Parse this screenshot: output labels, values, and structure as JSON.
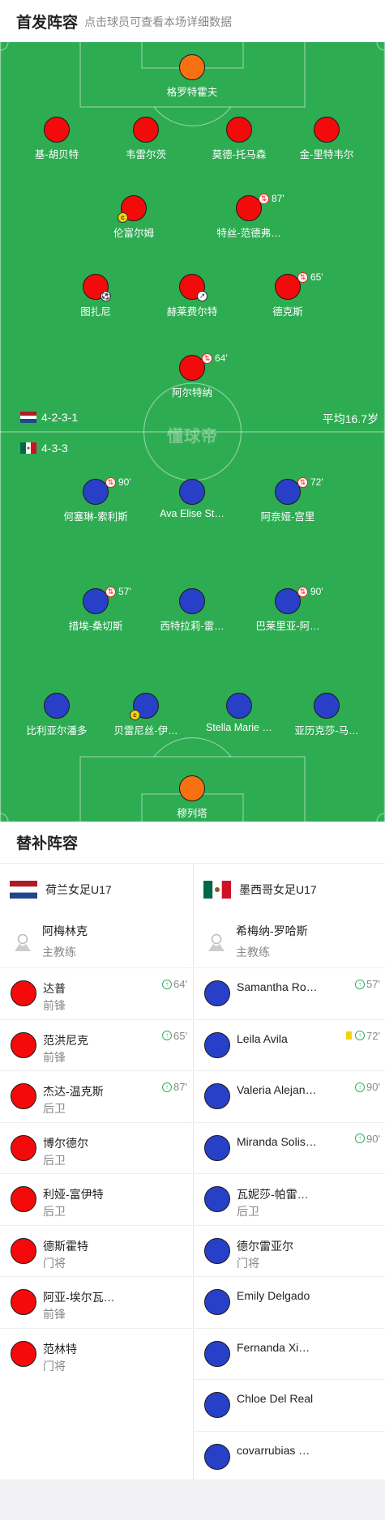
{
  "header": {
    "title": "首发阵容",
    "subtitle": "点击球员可查看本场详细数据"
  },
  "watermark": "懂球帝",
  "colors": {
    "home": "#f40a0a",
    "away": "#2840c8",
    "goalkeeper": "#f77113",
    "pitch": "#2eac52"
  },
  "home_team": {
    "name": "荷兰女足U17",
    "formation": "4-2-3-1",
    "flag": "netherlands-flag"
  },
  "away_team": {
    "name": "墨西哥女足U17",
    "formation": "4-3-3",
    "flag": "mexico-flag"
  },
  "average_age": "平均16.7岁",
  "home_lineup": [
    {
      "name": "格罗特霍夫",
      "kit": "orange"
    },
    {
      "name": "基-胡贝特",
      "kit": "red"
    },
    {
      "name": "韦雷尔茨",
      "kit": "red"
    },
    {
      "name": "莫德-托马森",
      "kit": "red"
    },
    {
      "name": "金-里特韦尔",
      "kit": "red"
    },
    {
      "name": "伦富尔姆",
      "kit": "red",
      "captain": "c"
    },
    {
      "name": "特丝-范德弗…",
      "kit": "red",
      "sub_minute": "87'"
    },
    {
      "name": "图扎尼",
      "kit": "red",
      "goal": true
    },
    {
      "name": "赫莱费尔特",
      "kit": "red",
      "assist": true
    },
    {
      "name": "德克斯",
      "kit": "red",
      "sub_minute": "65'"
    },
    {
      "name": "阿尔特纳",
      "kit": "red",
      "sub_minute": "64'"
    }
  ],
  "away_lineup": [
    {
      "name": "何塞琳-索利斯",
      "kit": "blue",
      "sub_minute": "90'"
    },
    {
      "name": "Ava Elise St…",
      "kit": "blue"
    },
    {
      "name": "阿奈娅-宫里",
      "kit": "blue",
      "sub_minute": "72'"
    },
    {
      "name": "措埃-桑切斯",
      "kit": "blue",
      "sub_minute": "57'"
    },
    {
      "name": "西特拉莉-雷…",
      "kit": "blue"
    },
    {
      "name": "巴莱里亚-阿…",
      "kit": "blue",
      "sub_minute": "90'"
    },
    {
      "name": "比利亚尔潘多",
      "kit": "blue"
    },
    {
      "name": "贝雷尼丝-伊…",
      "kit": "blue",
      "captain": "c"
    },
    {
      "name": "Stella Marie …",
      "kit": "blue"
    },
    {
      "name": "亚历克莎-马…",
      "kit": "blue"
    },
    {
      "name": "穆列塔",
      "kit": "orange"
    }
  ],
  "bench": {
    "title": "替补阵容",
    "home": {
      "coach": {
        "name": "阿梅林克",
        "role": "主教练"
      },
      "players": [
        {
          "name": "达普",
          "pos": "前锋",
          "minute": "64'"
        },
        {
          "name": "范洪尼克",
          "pos": "前锋",
          "minute": "65'"
        },
        {
          "name": "杰达-温克斯",
          "pos": "后卫",
          "minute": "87'"
        },
        {
          "name": "博尔德尔",
          "pos": "后卫"
        },
        {
          "name": "利娅-富伊特",
          "pos": "后卫"
        },
        {
          "name": "德斯霍特",
          "pos": "门将"
        },
        {
          "name": "阿亚-埃尔瓦…",
          "pos": "前锋"
        },
        {
          "name": "范林特",
          "pos": "门将"
        }
      ]
    },
    "away": {
      "coach": {
        "name": "希梅纳-罗哈斯",
        "role": "主教练"
      },
      "players": [
        {
          "name": "Samantha Ro…",
          "pos": "",
          "minute": "57'"
        },
        {
          "name": "Leila Avila",
          "pos": "",
          "minute": "72'",
          "yellow": true
        },
        {
          "name": "Valeria Alejan…",
          "pos": "",
          "minute": "90'"
        },
        {
          "name": "Miranda Solis…",
          "pos": "",
          "minute": "90'"
        },
        {
          "name": "瓦妮莎-帕雷…",
          "pos": "后卫"
        },
        {
          "name": "德尔雷亚尔",
          "pos": "门将"
        },
        {
          "name": "Emily Delgado",
          "pos": ""
        },
        {
          "name": "Fernanda Xi…",
          "pos": ""
        },
        {
          "name": "Chloe Del Real",
          "pos": ""
        },
        {
          "name": "covarrubias …",
          "pos": ""
        }
      ]
    }
  }
}
